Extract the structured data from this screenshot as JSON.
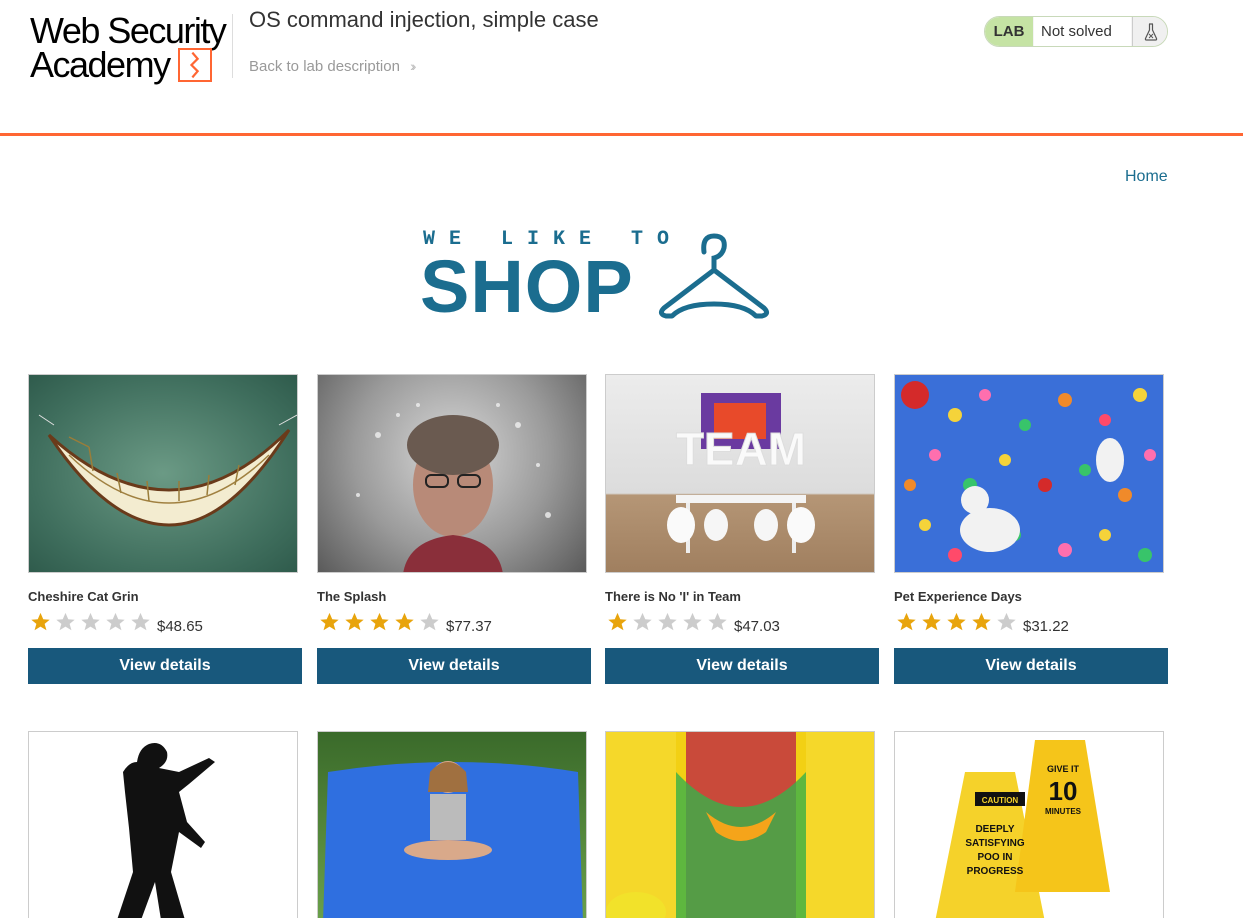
{
  "header": {
    "logo_line1": "Web Security",
    "logo_line2": "Academy",
    "lab_title": "OS command injection, simple case",
    "back_link": "Back to lab description",
    "status": {
      "tag": "LAB",
      "state": "Not solved",
      "icon": "flask-icon"
    },
    "accent": "#ff6633"
  },
  "nav": {
    "home": "Home"
  },
  "banner": {
    "small_text": "WE LIKE TO",
    "big_text": "SHOP",
    "icon": "hanger-icon",
    "color": "#1b6d8f"
  },
  "products": [
    {
      "name": "Cheshire Cat Grin",
      "rating": 1,
      "price": "$48.65",
      "button": "View details",
      "image": "cheshire-cat-grin-image"
    },
    {
      "name": "The Splash",
      "rating": 4,
      "price": "$77.37",
      "button": "View details",
      "image": "splash-image"
    },
    {
      "name": "There is No 'I' in Team",
      "rating": 1,
      "price": "$47.03",
      "button": "View details",
      "image": "team-image"
    },
    {
      "name": "Pet Experience Days",
      "rating": 4,
      "price": "$31.22",
      "button": "View details",
      "image": "pet-balloons-image"
    }
  ],
  "products_row2": [
    {
      "image": "silhouette-dancer-image"
    },
    {
      "image": "bean-bag-girl-image"
    },
    {
      "image": "bouncy-castle-image"
    },
    {
      "image": "caution-signs-image"
    }
  ],
  "colors": {
    "button": "#18587c",
    "star_on": "#e8a40c",
    "star_off": "#cccccc",
    "link": "#1b6d8f"
  }
}
